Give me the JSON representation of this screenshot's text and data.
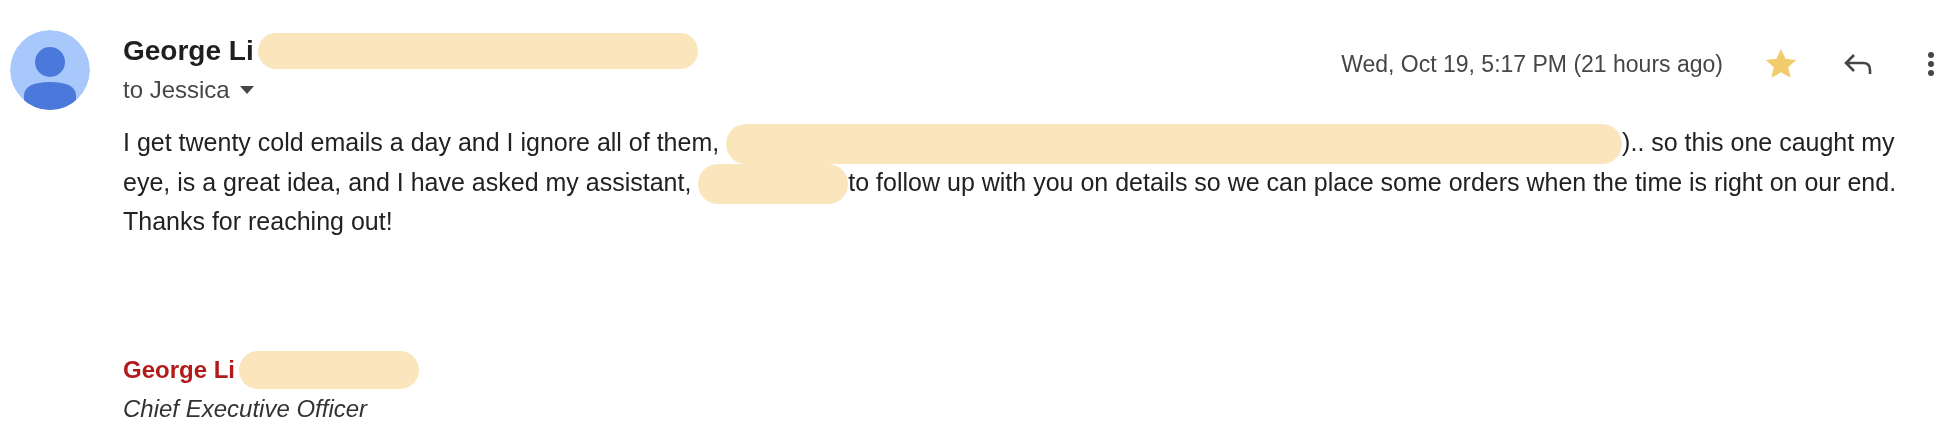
{
  "message": {
    "sender": "George Li",
    "sender_redacted": true,
    "recipient": "to Jessica",
    "date": "Wed, Oct 19, 5:17 PM (21 hours ago)",
    "starred": true,
    "body": [
      {
        "kind": "text",
        "text": "I get twenty cold emails a day and I ignore all of them, "
      },
      {
        "kind": "redaction"
      },
      {
        "kind": "text",
        "text": ").. so this one caught my eye, is a great idea, and I have asked my assistant, "
      },
      {
        "kind": "redaction"
      },
      {
        "kind": "text",
        "text": "to follow up with you on details so we can place some orders when the time is right on our end.  Thanks for reaching out!"
      }
    ],
    "signature": {
      "name": "George Li",
      "name_redacted": true,
      "title": "Chief Executive Officer"
    }
  }
}
